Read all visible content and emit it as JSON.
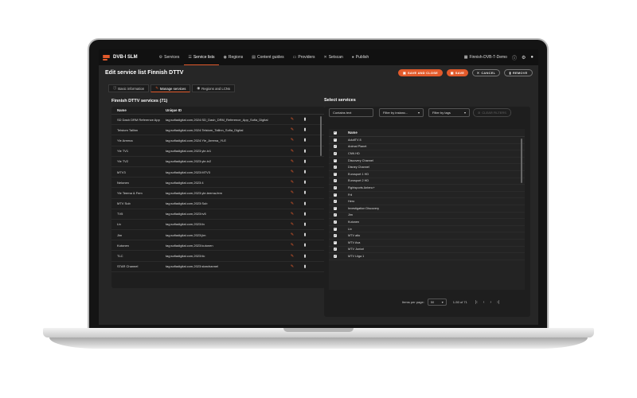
{
  "app": {
    "name": "DVB-I SLM",
    "nav": [
      {
        "label": "Services",
        "icon": "gear-icon",
        "glyph": "⚙"
      },
      {
        "label": "Service lists",
        "icon": "list-icon",
        "glyph": "☰"
      },
      {
        "label": "Regions",
        "icon": "globe-icon",
        "glyph": "◉"
      },
      {
        "label": "Content guides",
        "icon": "guide-icon",
        "glyph": "▤"
      },
      {
        "label": "Providers",
        "icon": "provider-icon",
        "glyph": "▭"
      },
      {
        "label": "Setscan",
        "icon": "setscan-icon",
        "glyph": "✕"
      },
      {
        "label": "Publish",
        "icon": "person-icon",
        "glyph": "●"
      }
    ],
    "active_nav": "Service lists",
    "workspace": "Finnish-DVB-T-Demo"
  },
  "page": {
    "title": "Edit service list Finnish DTTV",
    "buttons": {
      "save_and_close": "SAVE AND CLOSE",
      "save": "SAVE",
      "cancel": "CANCEL",
      "remove": "REMOVE"
    },
    "tabs": [
      {
        "label": "Basic information",
        "icon": "info-icon",
        "glyph": "ⓘ"
      },
      {
        "label": "Manage services",
        "icon": "edit-icon",
        "glyph": "✎"
      },
      {
        "label": "Regions and LCNs",
        "icon": "globe-icon",
        "glyph": "◉"
      }
    ],
    "active_tab": "Manage services"
  },
  "left": {
    "title": "Finnish DTTV services (71)",
    "columns": {
      "name": "Name",
      "id": "Unique ID"
    },
    "rows": [
      {
        "name": "SD Dash DRM Reference App",
        "id": "tag:sofiadigital.com,2024:SD_Dash_DRM_Reference_App_Sofia_Digital"
      },
      {
        "name": "Telstom Tallinn",
        "id": "tag:sofiadigital.com,2024:Telstom_Tallinn_Sofia_Digital"
      },
      {
        "name": "Yle Areena",
        "id": "tag:sofiadigital.com,2024:Yle_Areena_YLE"
      },
      {
        "name": "Yle TV1",
        "id": "tag:sofiadigital.com,2023:yle-tv1"
      },
      {
        "name": "Yle TV2",
        "id": "tag:sofiadigital.com,2023:yle-tv2"
      },
      {
        "name": "MTV3",
        "id": "tag:sofiadigital.com,2023:MTV3"
      },
      {
        "name": "Nelonen",
        "id": "tag:sofiadigital.com,2023:4"
      },
      {
        "name": "Yle Teema & Fem",
        "id": "tag:sofiadigital.com,2023:yle-teema-fem"
      },
      {
        "name": "MTV Sub",
        "id": "tag:sofiadigital.com,2023:Sub"
      },
      {
        "name": "TV5",
        "id": "tag:sofiadigital.com,2023:tv5"
      },
      {
        "name": "Liv",
        "id": "tag:sofiadigital.com,2023:liv"
      },
      {
        "name": "Jim",
        "id": "tag:sofiadigital.com,2023:jim"
      },
      {
        "name": "Kutonen",
        "id": "tag:sofiadigital.com,2023:kutonen"
      },
      {
        "name": "TLC",
        "id": "tag:sofiadigital.com,2023:tlc"
      },
      {
        "name": "STAR Channel",
        "id": "tag:sofiadigital.com,2023:starchannel"
      }
    ]
  },
  "right": {
    "title": "Select services",
    "search_placeholder": "Contains text",
    "filter_instance": "Filter by instanc...",
    "filter_tags": "Filter by tags",
    "clear_filters": "CLEAR FILTERS",
    "column_name": "Name",
    "rows": [
      "AdultTV 8",
      "Animal Planet",
      "CNN HD",
      "Discovery Channel",
      "Disney Channel",
      "Eurosport 1 HD",
      "Eurosport 2 HD",
      "Fightsports Antenc+",
      "Frii",
      "Hero",
      "Investigation Discovery",
      "Jim",
      "Kutonen",
      "Liv",
      "MTV aito",
      "MTV Ava",
      "MTV Juniori",
      "MTV Liiga 1"
    ],
    "pagination": {
      "items_per_page_label": "Items per page:",
      "items_per_page": "50",
      "range": "1-50 of 71"
    }
  },
  "colors": {
    "accent": "#e25a2b",
    "background": "#262626"
  }
}
